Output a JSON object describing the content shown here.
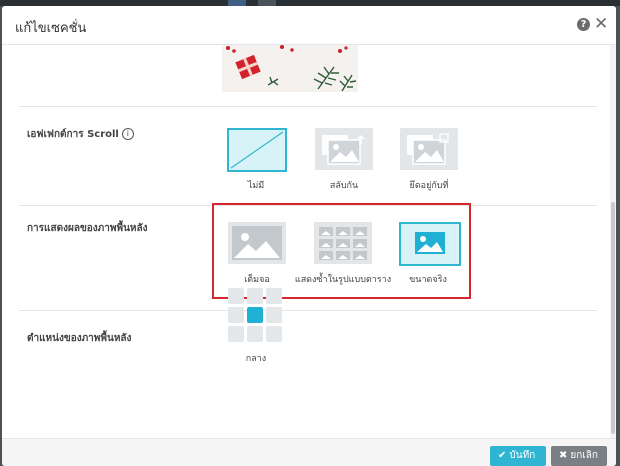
{
  "dialog": {
    "title": "แก้ไขเซคชั่น",
    "help_icon": "help-circle-icon",
    "close_icon": "close-icon"
  },
  "sections": {
    "scroll_effect": {
      "label": "เอฟเฟกต์การ Scroll",
      "info": "i",
      "options": [
        {
          "label": "ไม่มี",
          "selected": true,
          "icon": "none-diagonal-icon"
        },
        {
          "label": "สลับกัน",
          "selected": false,
          "icon": "image-parallax-icon"
        },
        {
          "label": "ยึดอยู่กับที่",
          "selected": false,
          "icon": "image-fixed-icon"
        }
      ]
    },
    "background_display": {
      "label": "การแสดงผลของภาพพื้นหลัง",
      "options": [
        {
          "label": "เต็มจอ",
          "selected": false,
          "icon": "image-cover-icon"
        },
        {
          "label": "แสดงซ้ำในรูปแบบตาราง",
          "selected": false,
          "icon": "image-tile-icon"
        },
        {
          "label": "ขนาดจริง",
          "selected": true,
          "icon": "image-actual-icon"
        }
      ]
    },
    "background_position": {
      "label": "ตำแหน่งของภาพพื้นหลัง",
      "selected": "กลาง",
      "selected_index": 4
    }
  },
  "footer": {
    "save_label": "บันทึก",
    "cancel_label": "ยกเลิก"
  },
  "colors": {
    "accent": "#2fb5d2",
    "highlight_box": "#d9252d",
    "cancel": "#7a7f84"
  }
}
